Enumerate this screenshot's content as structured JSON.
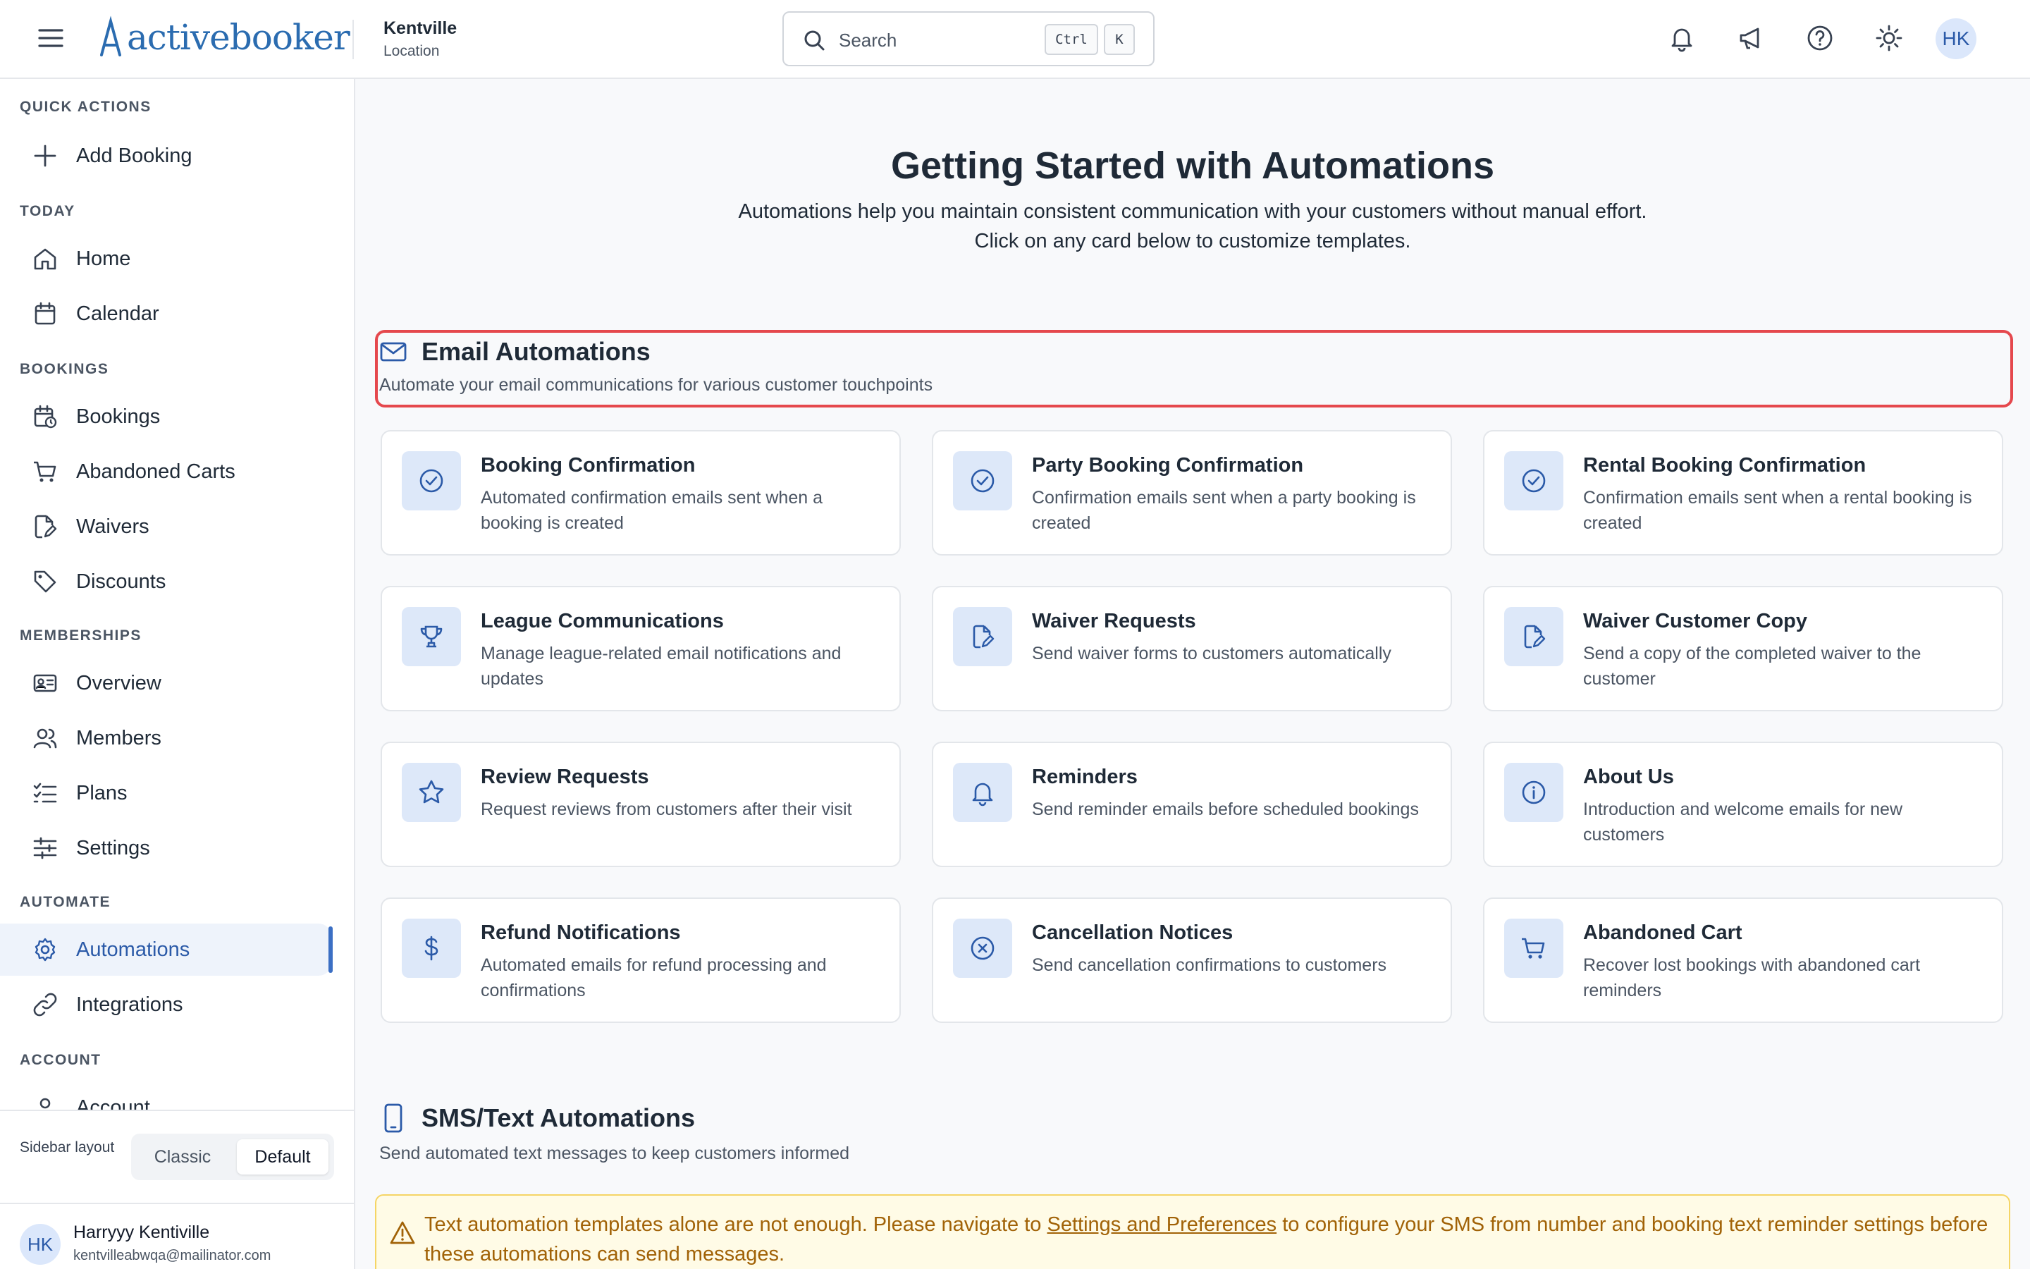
{
  "header": {
    "logo_text": "activebooker",
    "location_name": "Kentville",
    "location_sub": "Location",
    "search_placeholder": "Search",
    "kbd_ctrl": "Ctrl",
    "kbd_k": "K",
    "avatar_initials": "HK"
  },
  "sidebar": {
    "sections": {
      "quick_actions": "QUICK ACTIONS",
      "today": "TODAY",
      "bookings": "BOOKINGS",
      "memberships": "MEMBERSHIPS",
      "automate": "AUTOMATE",
      "account": "ACCOUNT"
    },
    "items": {
      "add_booking": "Add Booking",
      "home": "Home",
      "calendar": "Calendar",
      "bookings": "Bookings",
      "abandoned_carts": "Abandoned Carts",
      "waivers": "Waivers",
      "discounts": "Discounts",
      "overview": "Overview",
      "members": "Members",
      "plans": "Plans",
      "settings": "Settings",
      "automations": "Automations",
      "integrations": "Integrations",
      "account": "Account"
    },
    "layout_label": "Sidebar layout",
    "layout_classic": "Classic",
    "layout_default": "Default",
    "user_initials": "HK",
    "user_name": "Harryyy Kentiville",
    "user_email": "kentvilleabwqa@mailinator.com"
  },
  "main": {
    "title": "Getting Started with Automations",
    "subtitle_line1": "Automations help you maintain consistent communication with your customers without manual effort.",
    "subtitle_line2": "Click on any card below to customize templates.",
    "email": {
      "title": "Email Automations",
      "desc": "Automate your email communications for various customer touchpoints"
    },
    "cards": [
      {
        "title": "Booking Confirmation",
        "desc": "Automated confirmation emails sent when a booking is created",
        "icon": "check-circle-icon"
      },
      {
        "title": "Party Booking Confirmation",
        "desc": "Confirmation emails sent when a party booking is created",
        "icon": "check-circle-icon"
      },
      {
        "title": "Rental Booking Confirmation",
        "desc": "Confirmation emails sent when a rental booking is created",
        "icon": "check-circle-icon"
      },
      {
        "title": "League Communications",
        "desc": "Manage league-related email notifications and updates",
        "icon": "trophy-icon"
      },
      {
        "title": "Waiver Requests",
        "desc": "Send waiver forms to customers automatically",
        "icon": "file-pen-icon"
      },
      {
        "title": "Waiver Customer Copy",
        "desc": "Send a copy of the completed waiver to the customer",
        "icon": "file-pen-icon"
      },
      {
        "title": "Review Requests",
        "desc": "Request reviews from customers after their visit",
        "icon": "star-icon"
      },
      {
        "title": "Reminders",
        "desc": "Send reminder emails before scheduled bookings",
        "icon": "bell-icon"
      },
      {
        "title": "About Us",
        "desc": "Introduction and welcome emails for new customers",
        "icon": "info-icon"
      },
      {
        "title": "Refund Notifications",
        "desc": "Automated emails for refund processing and confirmations",
        "icon": "dollar-icon"
      },
      {
        "title": "Cancellation Notices",
        "desc": "Send cancellation confirmations to customers",
        "icon": "x-circle-icon"
      },
      {
        "title": "Abandoned Cart",
        "desc": "Recover lost bookings with abandoned cart reminders",
        "icon": "cart-icon"
      }
    ],
    "sms": {
      "title": "SMS/Text Automations",
      "desc": "Send automated text messages to keep customers informed"
    },
    "alert": {
      "before": "Text automation templates alone are not enough. Please navigate to ",
      "link": "Settings and Preferences",
      "after": " to configure your SMS from number and booking text reminder settings before these automations can send messages."
    }
  },
  "colors": {
    "accent": "#2b5aa8",
    "highlight_border": "#e5484d",
    "warning_text": "#a16207"
  }
}
